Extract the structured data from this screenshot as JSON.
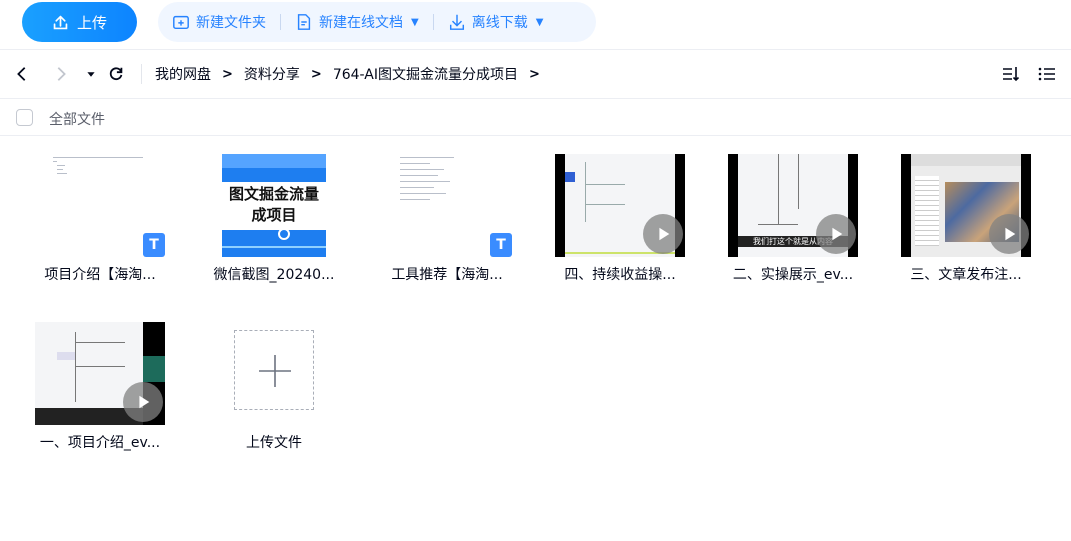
{
  "toolbar": {
    "upload_label": "上传",
    "new_folder": "新建文件夹",
    "new_online_doc": "新建在线文档",
    "offline_download": "离线下载"
  },
  "breadcrumb": {
    "items": [
      "我的网盘",
      "资料分享",
      "764-AI图文掘金流量分成项目"
    ]
  },
  "select_all_label": "全部文件",
  "files": [
    {
      "name": "项目介绍【海淘...",
      "type": "doc",
      "badge": "T"
    },
    {
      "name": "微信截图_20240...",
      "type": "image",
      "overlay_text": "图文掘金流量\n成项目"
    },
    {
      "name": "工具推荐【海淘...",
      "type": "doc",
      "badge": "T"
    },
    {
      "name": "四、持续收益操...",
      "type": "video"
    },
    {
      "name": "二、实操展示_ev...",
      "type": "video",
      "caption": "我们打这个就是从内容"
    },
    {
      "name": "三、文章发布注...",
      "type": "video"
    },
    {
      "name": "一、项目介绍_ev...",
      "type": "video"
    }
  ],
  "upload_tile_label": "上传文件",
  "colors": {
    "accent": "#2783ff",
    "upload_bg": "#0d84ff",
    "group_bg": "#f0f6ff"
  }
}
